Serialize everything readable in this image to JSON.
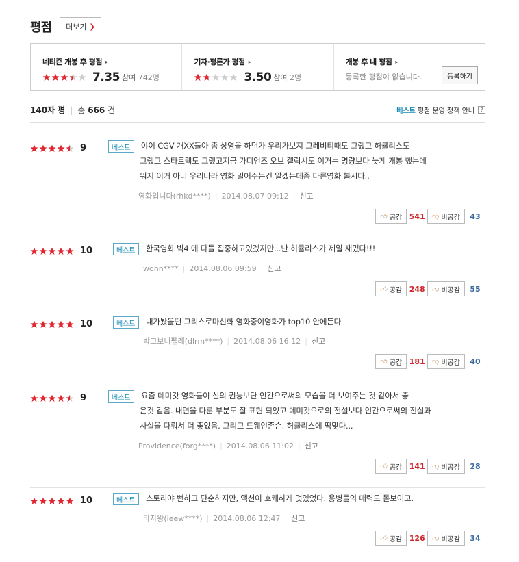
{
  "header": {
    "title": "평점",
    "more_label": "더보기"
  },
  "summary": [
    {
      "title": "네티즌 개봉 후 평점",
      "stars": 3.5,
      "score": "7.35",
      "participants_prefix": "참여",
      "participants": "742명"
    },
    {
      "title": "기자·평론가 평점",
      "stars": 1.75,
      "score": "3.50",
      "participants_prefix": "참여",
      "participants": "2명"
    },
    {
      "title": "개봉 후 내 평점",
      "empty_note": "등록한 평점이 없습니다.",
      "register_label": "등록하기"
    }
  ],
  "counts": {
    "chars": "140자 평",
    "total_prefix": "총",
    "total": "666",
    "total_suffix": "건",
    "policy_best": "베스트",
    "policy_text": "평점 운영 정책 안내",
    "policy_help": "?"
  },
  "colors": {
    "star": "#e0262f",
    "star_empty": "#cccccc",
    "best_border": "#5aa9c9",
    "best_text": "#1a8bb5",
    "positive": "#d0262d",
    "negative": "#3a6aa0"
  },
  "reviews": [
    {
      "score": "9",
      "stars": 4.5,
      "best": "베스트",
      "lines": [
        "야이 CGV 개XX들아 좀 상영을 하던가 우리가보지 그레비티때도 그랬고 허큘리스도",
        "그랬고 스타트랙도 그랬고지금 가디언즈 오브 갤럭시도 이거는 명량보다 늦게 개봉 했는데",
        "뭐지 이거 아니 우리나라 영화 밀어주는건 알겠는데좀 다른영화 봅시다.."
      ],
      "author": "영화입니다(rhkd****)",
      "date": "2014.08.07 09:12",
      "report": "신고",
      "like_label": "공감",
      "likes": "541",
      "dislike_label": "비공감",
      "dislikes": "43"
    },
    {
      "score": "10",
      "stars": 5,
      "best": "베스트",
      "lines": [
        "한국영화 빅4 에 다들 집중하고있겠지만...난 허큘리스가 제일 재밌다!!!"
      ],
      "author": "wonn****",
      "date": "2014.08.06 09:59",
      "report": "신고",
      "like_label": "공감",
      "likes": "248",
      "dislike_label": "비공감",
      "dislikes": "55"
    },
    {
      "score": "10",
      "stars": 5,
      "best": "베스트",
      "lines": [
        "내가봤을땐 그리스로마신화 영화중이영화가 top10 안에든다"
      ],
      "author": "박고보니펠레(dlrm****)",
      "date": "2014.08.06 16:12",
      "report": "신고",
      "like_label": "공감",
      "likes": "181",
      "dislike_label": "비공감",
      "dislikes": "40"
    },
    {
      "score": "9",
      "stars": 4.5,
      "best": "베스트",
      "lines": [
        "요즘 데미갓 영화들이 신의 권능보단 인간으로써의 모습을 더 보여주는 것 같아서 좋",
        "은것 같음. 내면을 다룬 부분도 잘 표현 되었고 데미갓으로의 전설보다 인간으로써의 진실과",
        "사실을 다뤄서 더 좋았음. 그리고 드웨인존슨. 허큘리스에 딱맞다..."
      ],
      "author": "Providence(forg****)",
      "date": "2014.08.06 11:02",
      "report": "신고",
      "like_label": "공감",
      "likes": "141",
      "dislike_label": "비공감",
      "dislikes": "28"
    },
    {
      "score": "10",
      "stars": 5,
      "best": "베스트",
      "lines": [
        "스토리야 뻔하고 단순하지만, 액션이 호쾌하게 멋있었다. 용병들의 매력도 돋보이고."
      ],
      "author": "타자왕(ieew****)",
      "date": "2014.08.06 12:47",
      "report": "신고",
      "like_label": "공감",
      "likes": "126",
      "dislike_label": "비공감",
      "dislikes": "34"
    }
  ]
}
